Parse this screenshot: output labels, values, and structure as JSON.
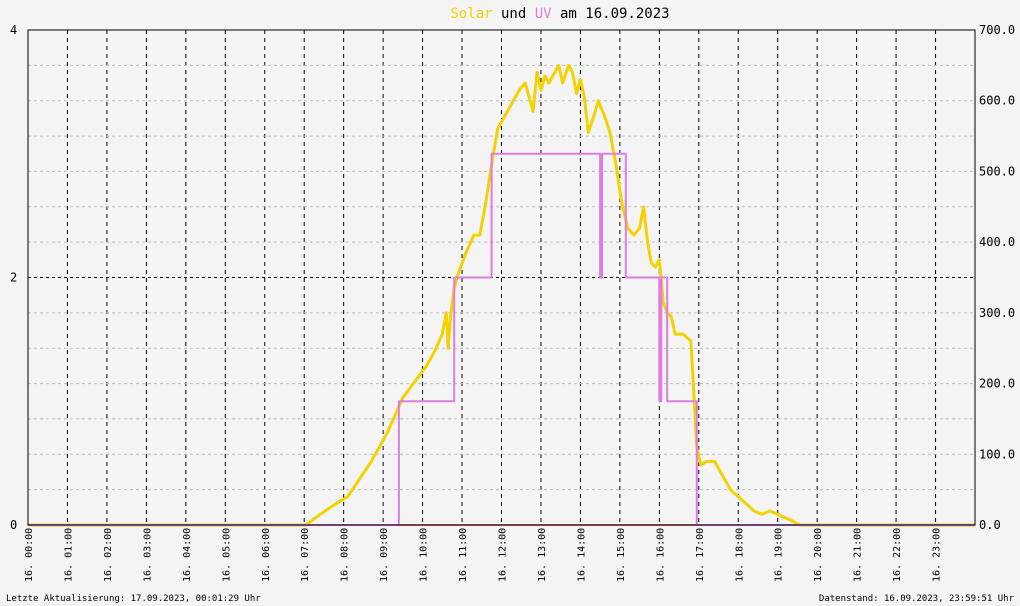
{
  "title": {
    "part1": "Solar",
    "part2": " und ",
    "part3": "UV",
    "part4": " am 16.09.2023"
  },
  "footer": {
    "left": "Letzte Aktualisierung: 17.09.2023, 00:01:29 Uhr",
    "right": "Datenstand: 16.09.2023, 23:59:51 Uhr"
  },
  "colors": {
    "solar": "#f2d200",
    "uv": "#e07ce0",
    "baseline": "#f08080",
    "background": "#f4f4f4"
  },
  "chart_data": {
    "type": "line",
    "title": "Solar und UV am 16.09.2023",
    "x_tick_labels": [
      "16. 00:00",
      "16. 01:00",
      "16. 02:00",
      "16. 03:00",
      "16. 04:00",
      "16. 05:00",
      "16. 06:00",
      "16. 07:00",
      "16. 08:00",
      "16. 09:00",
      "16. 10:00",
      "16. 11:00",
      "16. 12:00",
      "16. 13:00",
      "16. 14:00",
      "16. 15:00",
      "16. 16:00",
      "16. 17:00",
      "16. 18:00",
      "16. 19:00",
      "16. 20:00",
      "16. 21:00",
      "16. 22:00",
      "16. 23:00"
    ],
    "xlim": [
      0,
      24
    ],
    "y_left": {
      "ylim": [
        0,
        4
      ],
      "ticks": [
        "0",
        "2",
        "4"
      ]
    },
    "y_right": {
      "ylim": [
        0,
        700
      ],
      "ticks": [
        "0.0",
        "100.0",
        "200.0",
        "300.0",
        "400.0",
        "500.0",
        "600.0",
        "700.0"
      ]
    },
    "grid": true,
    "series": [
      {
        "name": "Solar",
        "axis": "right",
        "x": [
          0,
          7.05,
          7.4,
          7.8,
          8.1,
          8.4,
          8.7,
          8.9,
          9.1,
          9.3,
          9.5,
          9.7,
          9.9,
          10.1,
          10.3,
          10.5,
          10.6,
          10.65,
          10.7,
          10.8,
          10.9,
          11.1,
          11.3,
          11.45,
          11.6,
          11.75,
          11.9,
          12.1,
          12.3,
          12.45,
          12.6,
          12.8,
          12.9,
          13.0,
          13.1,
          13.2,
          13.35,
          13.45,
          13.55,
          13.7,
          13.8,
          13.9,
          14.0,
          14.1,
          14.2,
          14.35,
          14.45,
          14.6,
          14.75,
          14.9,
          15.05,
          15.2,
          15.35,
          15.5,
          15.6,
          15.7,
          15.8,
          15.9,
          16.0,
          16.1,
          16.2,
          16.3,
          16.4,
          16.6,
          16.8,
          16.95,
          17.05,
          17.2,
          17.4,
          17.6,
          17.8,
          18.0,
          18.2,
          18.4,
          18.6,
          18.8,
          19.0,
          19.2,
          19.4,
          19.55,
          19.7,
          24
        ],
        "y": [
          0,
          0,
          15,
          30,
          40,
          65,
          90,
          110,
          130,
          155,
          180,
          195,
          210,
          225,
          245,
          270,
          300,
          250,
          290,
          335,
          355,
          385,
          410,
          410,
          455,
          510,
          560,
          580,
          600,
          615,
          625,
          585,
          640,
          615,
          635,
          625,
          640,
          650,
          625,
          650,
          640,
          610,
          630,
          605,
          555,
          580,
          600,
          580,
          555,
          510,
          455,
          420,
          410,
          420,
          450,
          400,
          370,
          365,
          375,
          315,
          300,
          295,
          270,
          270,
          260,
          110,
          85,
          90,
          90,
          70,
          50,
          40,
          30,
          20,
          15,
          20,
          15,
          10,
          5,
          0,
          0,
          0
        ]
      },
      {
        "name": "UV",
        "axis": "left",
        "x": [
          0,
          9.4,
          9.4,
          10.8,
          10.8,
          11.75,
          11.75,
          14.5,
          14.5,
          14.55,
          14.55,
          14.6,
          14.6,
          15.15,
          15.15,
          16.0,
          16.0,
          16.05,
          16.05,
          16.2,
          16.2,
          16.95,
          16.95,
          24
        ],
        "y": [
          0,
          0,
          1,
          1,
          2,
          2,
          3,
          3,
          2,
          2,
          3,
          3,
          3,
          3,
          2,
          2,
          1,
          1,
          2,
          2,
          1,
          1,
          0,
          0
        ]
      }
    ]
  }
}
